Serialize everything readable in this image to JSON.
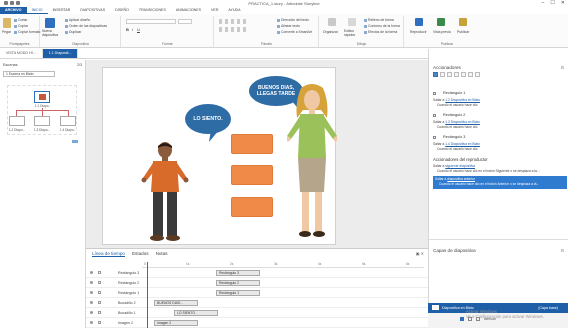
{
  "window": {
    "title": "PRACTICA_1.story - Articulate Storyline",
    "controls": [
      "–",
      "☐",
      "✕"
    ]
  },
  "ribbon_tabs": [
    "ARCHIVO",
    "INICIO",
    "INSERTAR",
    "DIAPOSITIVAS",
    "DISEÑO",
    "TRANSICIONES",
    "ANIMACIONES",
    "VER",
    "AYUDA"
  ],
  "ribbon": {
    "portapapeles": {
      "label": "Portapapeles",
      "paste": "Pegar",
      "cut": "Cortar",
      "copy": "Copiar",
      "format": "Copiar formato"
    },
    "diapositiva": {
      "label": "Diapositiva",
      "new": "Nueva diapositiva",
      "layout": "Aplicar diseño",
      "order": "Orden de las diapositivas",
      "duplicate": "Duplicar"
    },
    "fuente": {
      "label": "Fuente"
    },
    "parrafo": {
      "label": "Párrafo",
      "dir": "Dirección del texto",
      "align": "Alinear texto",
      "smartart": "Convertir a SmartArt"
    },
    "dibujo": {
      "label": "Dibujo",
      "arrange": "Organizar",
      "styles": "Estilos rápidos",
      "fill": "Relleno de forma",
      "outline": "Contorno de la forma",
      "effects": "Efectos de la forma"
    },
    "publicar": {
      "label": "Publicar",
      "preview": "Reproducir",
      "preview_slide": "Vista previa",
      "publish": "Publicar"
    }
  },
  "doc_tabs": {
    "story": "VISTA MODO HI...",
    "slide": "1.1 Diapositi..."
  },
  "scenes": {
    "header": "Escenas",
    "zoom": "2/3",
    "selected_scene": "1 Escena en Blato",
    "main_slide_label": "1.1 Diapo...",
    "sub_slides": [
      "1.2 Diapo...",
      "1.3 Diapo...",
      "1.4 Diapo..."
    ]
  },
  "slide": {
    "bubble_left": "LO SIENTO.",
    "bubble_right": "BUENOS DIAS, LLEGAS TARDE"
  },
  "timeline": {
    "tabs": [
      "Línea de tiempo",
      "Estados",
      "Notas"
    ],
    "ruler": [
      "0",
      "1s",
      "2s",
      "3s",
      "4s",
      "5s",
      "6s"
    ],
    "rows": [
      {
        "name": "Rectángulo 3",
        "bar": "Rectángulo 3"
      },
      {
        "name": "Rectángulo 2",
        "bar": "Rectángulo 2"
      },
      {
        "name": "Rectángulo 1",
        "bar": "Rectángulo 1"
      },
      {
        "name": "Bocadillo 2",
        "bar": "BUENOS DIAS..."
      },
      {
        "name": "Bocadillo 1",
        "bar": "LO SIENTO."
      },
      {
        "name": "Imagen 2",
        "bar": "Imagen 2"
      }
    ]
  },
  "triggers": {
    "header": "Accionadores",
    "items": [
      {
        "name": "Rectángulo 1",
        "line1_pre": "Saltar a ",
        "line1_link": "1.2 Diapositiva en Blato",
        "line2": "Cuando el usuario hace clic"
      },
      {
        "name": "Rectángulo 2",
        "line1_pre": "Saltar a ",
        "line1_link": "1.3 Diapositiva en Blato",
        "line2": "Cuando el usuario hace clic"
      },
      {
        "name": "Rectángulo 3",
        "line1_pre": "Saltar a ",
        "line1_link": "1.4 Diapositiva en Blato",
        "line2": "Cuando el usuario hace clic"
      }
    ],
    "player_header": "Accionadores del reproductor",
    "player": [
      {
        "line1_pre": "Saltar a ",
        "line1_link": "siguiente diapositiva",
        "line2": "Cuando el usuario hace clic en el botón Siguiente o se desplaza a la..."
      },
      {
        "line1_pre": "Saltar a ",
        "line1_link": "diapositiva anterior",
        "line2": "Cuando el usuario hace clic en el botón Anterior o se desplaza a la..."
      }
    ]
  },
  "layers": {
    "header": "Capas de diapositiva",
    "base": "Diapositiva en Blato",
    "base_tag": "(Capa base)",
    "dim_label": "Atenuar"
  },
  "watermark": [
    "Activar Windows",
    "Ve a Configuración para activar Windows."
  ],
  "colors": {
    "accent": "#1f5fa8",
    "bubble": "#2e6ca6",
    "rect": "#f08a48"
  }
}
